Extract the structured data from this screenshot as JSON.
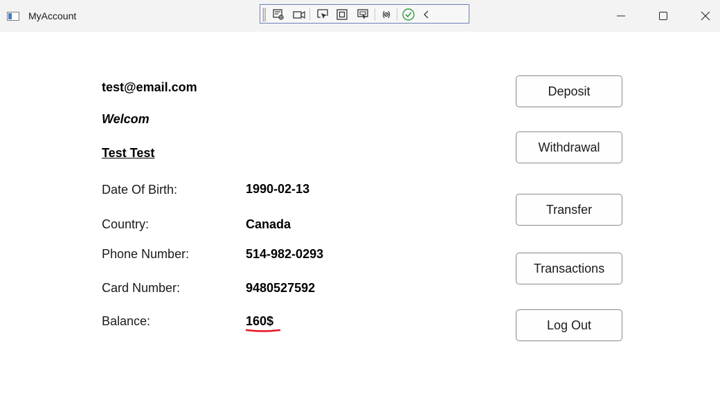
{
  "window": {
    "title": "MyAccount",
    "app_icon": "window-app-icon",
    "controls": [
      "minimize-icon",
      "maximize-icon",
      "close-icon"
    ]
  },
  "debug_toolbar": {
    "icons": [
      "select-element-icon",
      "camera-icon",
      "pointer-select-icon",
      "layout-adorner-icon",
      "track-focus-icon",
      "binding-failures-icon",
      "hot-reload-ok-icon",
      "collapse-chevron-icon"
    ]
  },
  "account": {
    "email": "test@email.com",
    "greeting": "Welcom",
    "name": "Test Test"
  },
  "fields": {
    "dob_label": "Date Of Birth:",
    "dob_value": "1990-02-13",
    "country_label": "Country:",
    "country_value": "Canada",
    "phone_label": "Phone Number:",
    "phone_value": "514-982-0293",
    "card_label": "Card Number:",
    "card_value": "9480527592",
    "balance_label": "Balance:",
    "balance_value": "160$"
  },
  "actions": {
    "deposit": "Deposit",
    "withdrawal": "Withdrawal",
    "transfer": "Transfer",
    "transactions": "Transactions",
    "logout": "Log Out"
  },
  "colors": {
    "titlebar_bg": "#f3f3f3",
    "toolbar_border": "#6c7fb5",
    "error_underline": "#e81123",
    "hot_reload_ok": "#2e9e3e"
  }
}
